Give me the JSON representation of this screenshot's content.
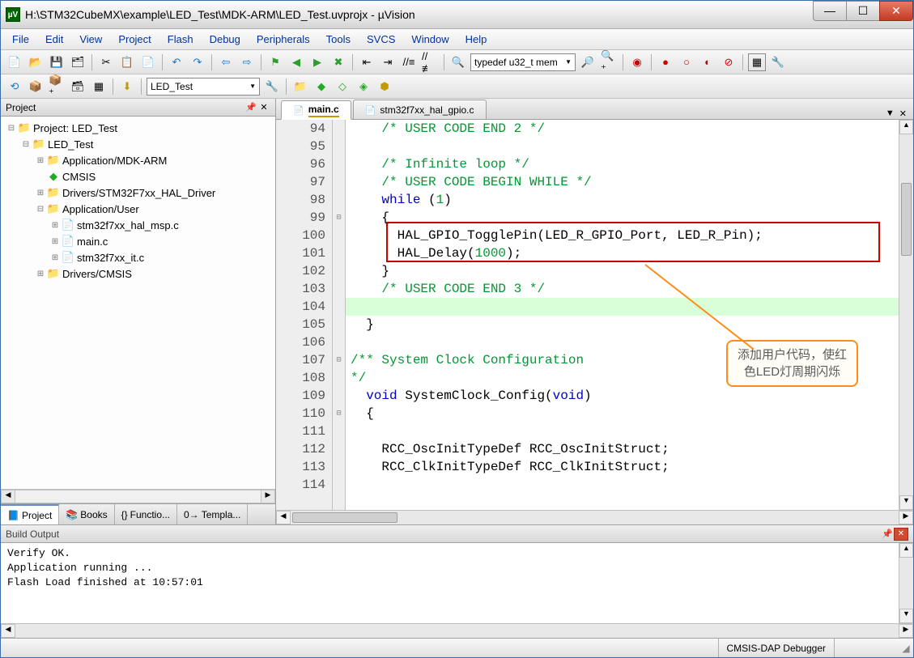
{
  "window": {
    "title": "H:\\STM32CubeMX\\example\\LED_Test\\MDK-ARM\\LED_Test.uvprojx - µVision",
    "app_icon_letter": "µV"
  },
  "menu": [
    "File",
    "Edit",
    "View",
    "Project",
    "Flash",
    "Debug",
    "Peripherals",
    "Tools",
    "SVCS",
    "Window",
    "Help"
  ],
  "toolbar1": {
    "find_text": "typedef u32_t mem"
  },
  "toolbar2": {
    "target": "LED_Test"
  },
  "project_panel": {
    "title": "Project",
    "tree": [
      {
        "depth": 0,
        "exp": "⊟",
        "icon": "📁",
        "label": "Project: LED_Test",
        "icolor": "#c79600"
      },
      {
        "depth": 1,
        "exp": "⊟",
        "icon": "📁",
        "label": "LED_Test",
        "icolor": "#d9a000"
      },
      {
        "depth": 2,
        "exp": "⊞",
        "icon": "📁",
        "label": "Application/MDK-ARM",
        "icolor": "#d9a000"
      },
      {
        "depth": 2,
        "exp": "",
        "icon": "◆",
        "label": "CMSIS",
        "icolor": "#22aa22"
      },
      {
        "depth": 2,
        "exp": "⊞",
        "icon": "📁",
        "label": "Drivers/STM32F7xx_HAL_Driver",
        "icolor": "#d9a000"
      },
      {
        "depth": 2,
        "exp": "⊟",
        "icon": "📁",
        "label": "Application/User",
        "icolor": "#d9a000"
      },
      {
        "depth": 3,
        "exp": "⊞",
        "icon": "📄",
        "label": "stm32f7xx_hal_msp.c",
        "icolor": "#888"
      },
      {
        "depth": 3,
        "exp": "⊞",
        "icon": "📄",
        "label": "main.c",
        "icolor": "#888"
      },
      {
        "depth": 3,
        "exp": "⊞",
        "icon": "📄",
        "label": "stm32f7xx_it.c",
        "icolor": "#888"
      },
      {
        "depth": 2,
        "exp": "⊞",
        "icon": "📁",
        "label": "Drivers/CMSIS",
        "icolor": "#d9a000"
      }
    ],
    "tabs": [
      {
        "icon": "📘",
        "label": "Project",
        "active": true
      },
      {
        "icon": "📚",
        "label": "Books"
      },
      {
        "icon": "{}",
        "label": "Functio..."
      },
      {
        "icon": "0→",
        "label": "Templa..."
      }
    ]
  },
  "editor": {
    "tabs": [
      {
        "label": "main.c",
        "active": true
      },
      {
        "label": "stm32f7xx_hal_gpio.c"
      }
    ],
    "lines": [
      {
        "n": 94,
        "fold": "",
        "segs": [
          {
            "t": "    ",
            "c": ""
          },
          {
            "t": "/* USER CODE END 2 */",
            "c": "c-comment"
          }
        ]
      },
      {
        "n": 95,
        "fold": "",
        "segs": []
      },
      {
        "n": 96,
        "fold": "",
        "segs": [
          {
            "t": "    ",
            "c": ""
          },
          {
            "t": "/* Infinite loop */",
            "c": "c-comment"
          }
        ]
      },
      {
        "n": 97,
        "fold": "",
        "segs": [
          {
            "t": "    ",
            "c": ""
          },
          {
            "t": "/* USER CODE BEGIN WHILE */",
            "c": "c-comment"
          }
        ]
      },
      {
        "n": 98,
        "fold": "",
        "segs": [
          {
            "t": "    ",
            "c": ""
          },
          {
            "t": "while",
            "c": "c-keyword"
          },
          {
            "t": " (",
            "c": ""
          },
          {
            "t": "1",
            "c": "c-number"
          },
          {
            "t": ")",
            "c": ""
          }
        ]
      },
      {
        "n": 99,
        "fold": "⊟",
        "segs": [
          {
            "t": "    {",
            "c": ""
          }
        ]
      },
      {
        "n": 100,
        "fold": "",
        "segs": [
          {
            "t": "      HAL_GPIO_TogglePin(LED_R_GPIO_Port, LED_R_Pin);",
            "c": ""
          }
        ]
      },
      {
        "n": 101,
        "fold": "",
        "segs": [
          {
            "t": "      HAL_Delay(",
            "c": ""
          },
          {
            "t": "1000",
            "c": "c-number"
          },
          {
            "t": ");",
            "c": ""
          }
        ]
      },
      {
        "n": 102,
        "fold": "",
        "segs": [
          {
            "t": "    }",
            "c": ""
          }
        ]
      },
      {
        "n": 103,
        "fold": "",
        "segs": [
          {
            "t": "    ",
            "c": ""
          },
          {
            "t": "/* USER CODE END 3 */",
            "c": "c-comment"
          }
        ]
      },
      {
        "n": 104,
        "fold": "",
        "hl": true,
        "segs": [
          {
            "t": "  ",
            "c": ""
          }
        ]
      },
      {
        "n": 105,
        "fold": "",
        "segs": [
          {
            "t": "  }",
            "c": ""
          }
        ]
      },
      {
        "n": 106,
        "fold": "",
        "segs": []
      },
      {
        "n": 107,
        "fold": "⊟",
        "segs": [
          {
            "t": "",
            "c": ""
          },
          {
            "t": "/** System Clock Configuration",
            "c": "c-comment"
          }
        ]
      },
      {
        "n": 108,
        "fold": "",
        "segs": [
          {
            "t": "",
            "c": ""
          },
          {
            "t": "*/",
            "c": "c-comment"
          }
        ]
      },
      {
        "n": 109,
        "fold": "",
        "segs": [
          {
            "t": "  ",
            "c": ""
          },
          {
            "t": "void",
            "c": "c-keyword"
          },
          {
            "t": " SystemClock_Config(",
            "c": ""
          },
          {
            "t": "void",
            "c": "c-keyword"
          },
          {
            "t": ")",
            "c": ""
          }
        ]
      },
      {
        "n": 110,
        "fold": "⊟",
        "segs": [
          {
            "t": "  {",
            "c": ""
          }
        ]
      },
      {
        "n": 111,
        "fold": "",
        "segs": []
      },
      {
        "n": 112,
        "fold": "",
        "segs": [
          {
            "t": "    RCC_OscInitTypeDef RCC_OscInitStruct;",
            "c": ""
          }
        ]
      },
      {
        "n": 113,
        "fold": "",
        "segs": [
          {
            "t": "    RCC_ClkInitTypeDef RCC_ClkInitStruct;",
            "c": ""
          }
        ]
      },
      {
        "n": 114,
        "fold": "",
        "segs": []
      }
    ],
    "callout": {
      "line1": "添加用户代码，使红",
      "line2": "色LED灯周期闪烁"
    }
  },
  "build": {
    "title": "Build Output",
    "lines": [
      "Verify OK.",
      "Application running ...",
      "Flash Load finished at 10:57:01"
    ]
  },
  "status": {
    "debugger": "CMSIS-DAP Debugger"
  }
}
